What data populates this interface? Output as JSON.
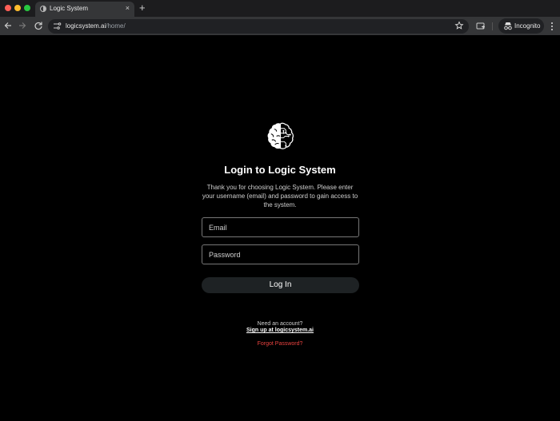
{
  "browser": {
    "tab": {
      "title": "Logic System",
      "close_glyph": "×"
    },
    "new_tab_glyph": "+",
    "url": {
      "host": "logicsystem.ai",
      "path": "/home/"
    },
    "incognito_label": "Incognito",
    "icons": [
      "back-arrow-icon",
      "forward-arrow-icon",
      "reload-icon",
      "site-info-icon",
      "bookmark-star-icon",
      "media-controls-icon",
      "incognito-icon",
      "more-menu-icon"
    ]
  },
  "login": {
    "logo_icon": "brain-circuit-icon",
    "title": "Login to Logic System",
    "subtitle": "Thank you for choosing Logic System. Please enter your username (email) and password to gain access to the system.",
    "email_placeholder": "Email",
    "email_value": "",
    "password_placeholder": "Password",
    "password_value": "",
    "login_button": "Log In",
    "need_account": "Need an account?",
    "signup_link": "Sign up at logicsystem.ai",
    "forgot_link": "Forgot Password?"
  },
  "colors": {
    "page_background": "#000000",
    "tabstrip": "#1c1c1e",
    "toolbar": "#353638",
    "button": "#1e2224",
    "forgot_link": "#e8423f"
  }
}
